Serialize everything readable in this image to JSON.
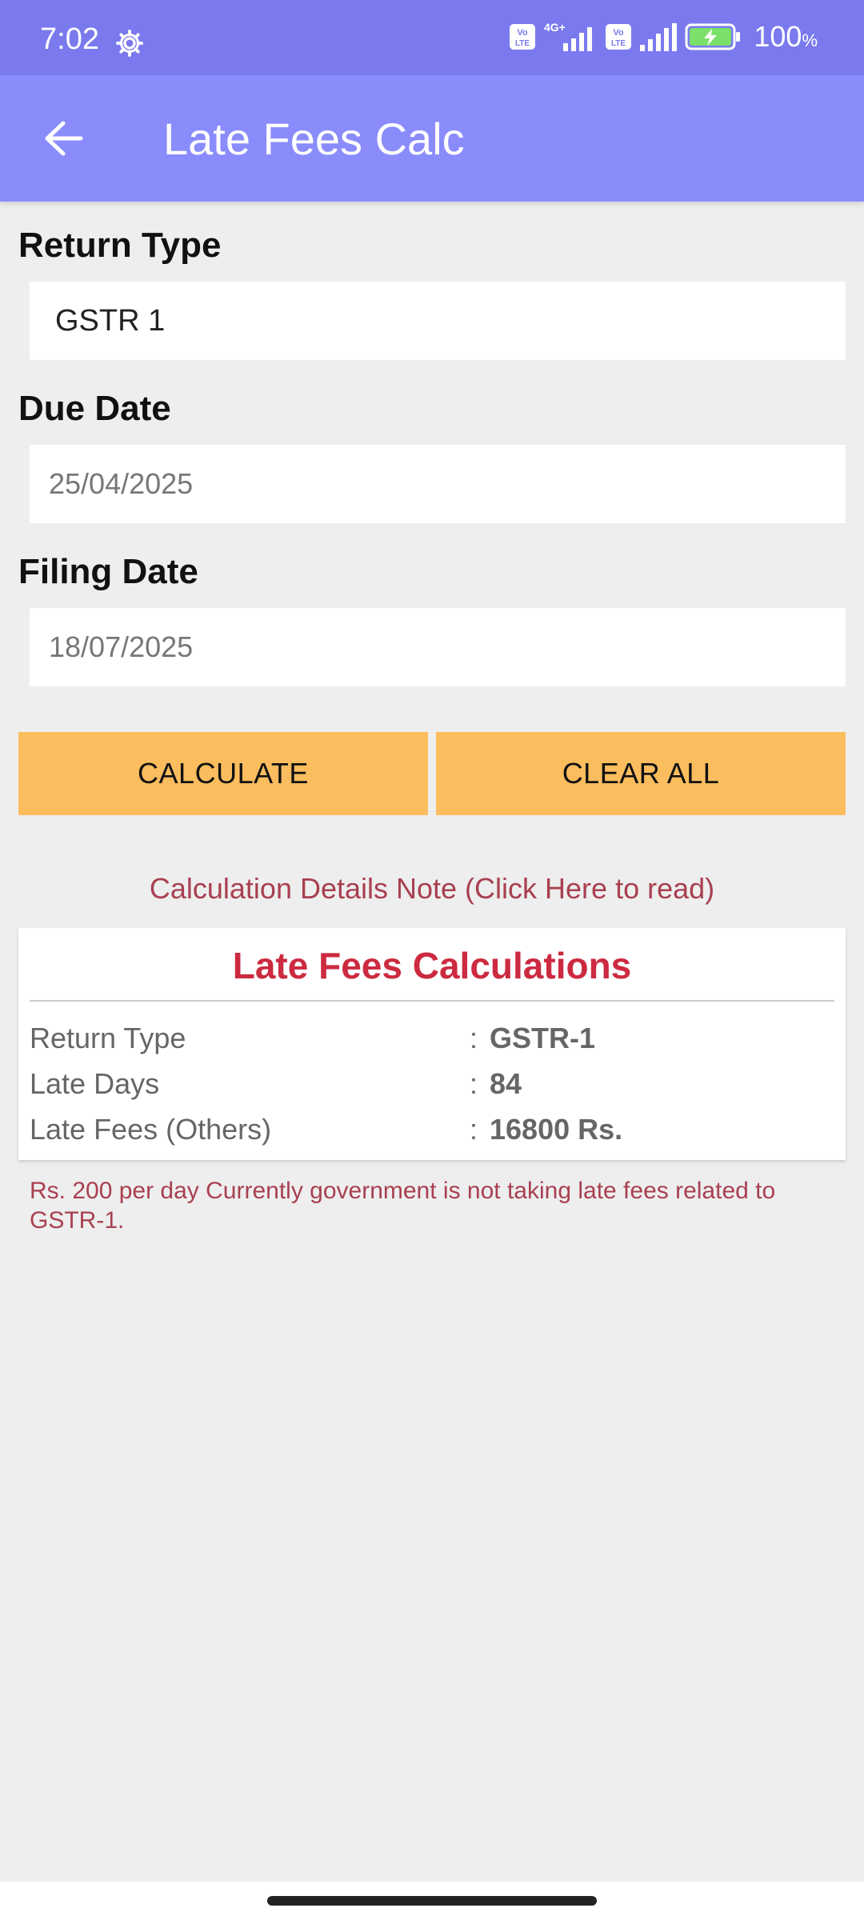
{
  "status_bar": {
    "time": "7:02",
    "battery": "100",
    "battery_unit": "%",
    "network_1": "4G+",
    "volte_label": "Vo LTE"
  },
  "app_bar": {
    "title": "Late Fees Calc",
    "back_icon": "arrow-left-icon"
  },
  "form": {
    "return_type": {
      "label": "Return Type",
      "value": "GSTR 1"
    },
    "due_date": {
      "label": "Due Date",
      "value": "25/04/2025"
    },
    "filing_date": {
      "label": "Filing Date",
      "value": "18/07/2025"
    }
  },
  "buttons": {
    "calculate": "CALCULATE",
    "clear_all": "CLEAR ALL"
  },
  "note_link": "Calculation Details Note (Click Here to read)",
  "results": {
    "title": "Late Fees Calculations",
    "rows": [
      {
        "label": "Return Type",
        "colon": ":",
        "value": "GSTR-1"
      },
      {
        "label": "Late Days",
        "colon": ":",
        "value": "84"
      },
      {
        "label": "Late Fees (Others)",
        "colon": ":",
        "value": "16800 Rs."
      }
    ]
  },
  "footnote": "Rs. 200 per day Currently government is not taking late fees related to GSTR-1.",
  "colors": {
    "status_bar": "#7a7aee",
    "app_bar": "#8a8cfc",
    "button": "#fbbd5e",
    "accent_red": "#cc2a40",
    "note_text": "#a84050",
    "background": "#eeeeee"
  }
}
